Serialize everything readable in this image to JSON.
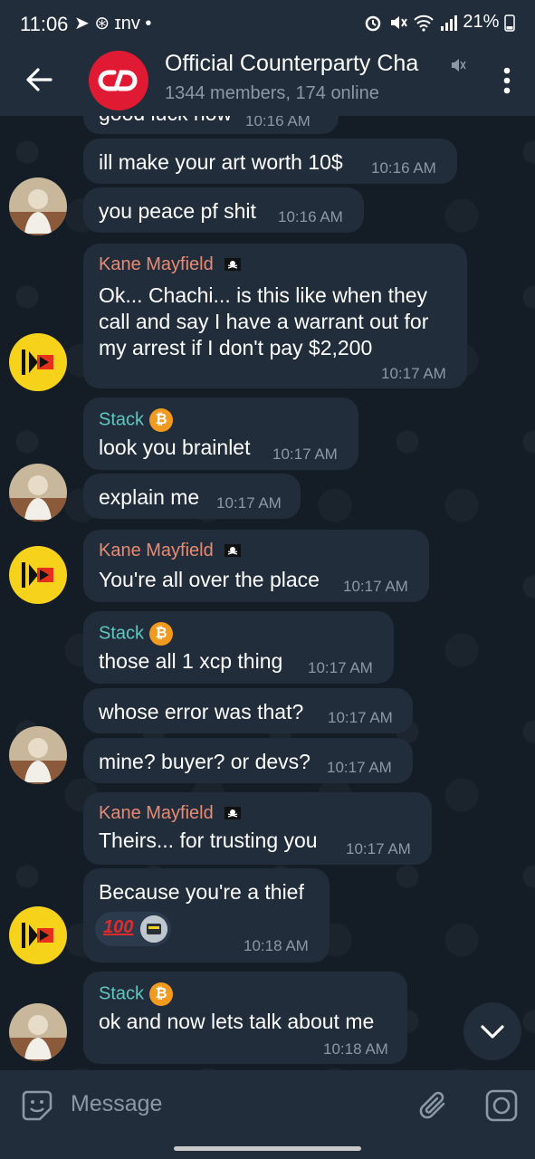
{
  "status_bar": {
    "time": "11:06",
    "left_icons": "➤ ⊛ ɪnv •",
    "battery": "21%"
  },
  "header": {
    "title": "Official Counterparty Cha",
    "subtitle": "1344 members, 174 online"
  },
  "messages": [
    {
      "sender": "",
      "text": [
        "good luck now"
      ],
      "time": "10:16 AM"
    },
    {
      "sender": "",
      "text": [
        "ill make your art worth 10$"
      ],
      "time": "10:16 AM"
    },
    {
      "sender": "",
      "text": [
        "you peace pf shit"
      ],
      "time": "10:16 AM"
    },
    {
      "sender": "Kane Mayfield",
      "text": [
        "Ok... Chachi... is this like when they",
        "call and say I have a warrant out for",
        "my arrest if I don't pay $2,200"
      ],
      "time": "10:17 AM"
    },
    {
      "sender": "Stack",
      "text": [
        "look you brainlet"
      ],
      "time": "10:17 AM"
    },
    {
      "sender": "",
      "text": [
        "explain me"
      ],
      "time": "10:17 AM"
    },
    {
      "sender": "Kane Mayfield",
      "text": [
        "You're all over the place"
      ],
      "time": "10:17 AM"
    },
    {
      "sender": "Stack",
      "text": [
        "those all 1 xcp thing"
      ],
      "time": "10:17 AM"
    },
    {
      "sender": "",
      "text": [
        "whose error was that?"
      ],
      "time": "10:17 AM"
    },
    {
      "sender": "",
      "text": [
        "mine? buyer? or devs?"
      ],
      "time": "10:17 AM"
    },
    {
      "sender": "Kane Mayfield",
      "text": [
        "Theirs... for trusting you"
      ],
      "time": "10:17 AM"
    },
    {
      "sender": "",
      "text": [
        "Because you're a thief"
      ],
      "time": "10:18 AM"
    },
    {
      "sender": "Stack",
      "text": [
        "ok and now lets talk about me"
      ],
      "time": "10:18 AM"
    }
  ],
  "badges": {
    "bitcoin": "₿"
  },
  "reactions": {
    "hundred": "100"
  },
  "composer": {
    "placeholder": "Message"
  },
  "colors": {
    "kane_name": "#e98b73",
    "stack_name": "#5fc7c0",
    "bubble": "#212d3b",
    "header": "#212d3b"
  }
}
